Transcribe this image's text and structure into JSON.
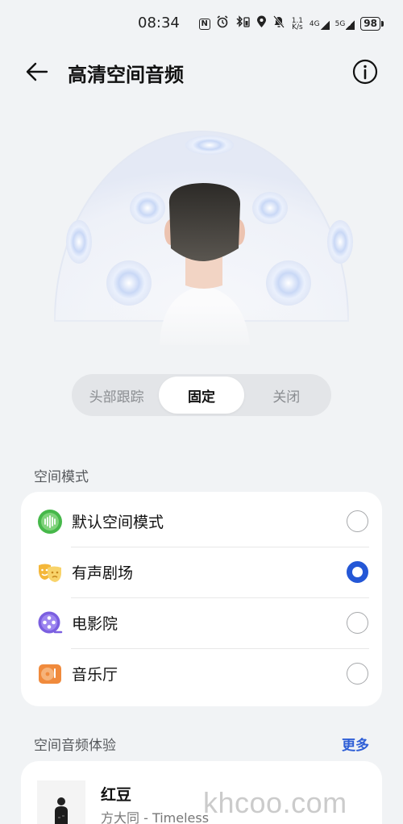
{
  "status_bar": {
    "time": "08:34",
    "nfc": "N",
    "speed_top": "1.1",
    "speed_bottom": "K/s",
    "sig1_label": "4G",
    "sig2_label": "5G",
    "battery": "98"
  },
  "header": {
    "title": "高清空间音频"
  },
  "segmented": {
    "options": [
      "头部跟踪",
      "固定",
      "关闭"
    ],
    "selected": "固定"
  },
  "spatial_mode": {
    "title": "空间模式",
    "items": [
      {
        "label": "默认空间模式",
        "icon": "waveform-icon",
        "color": "#46b84a",
        "selected": false
      },
      {
        "label": "有声剧场",
        "icon": "theater-masks-icon",
        "color": "#f4b73a",
        "selected": true
      },
      {
        "label": "电影院",
        "icon": "film-reel-icon",
        "color": "#7b5fe0",
        "selected": false
      },
      {
        "label": "音乐厅",
        "icon": "music-disc-icon",
        "color": "#f08a3c",
        "selected": false
      }
    ]
  },
  "experience": {
    "title": "空间音频体验",
    "more_label": "更多",
    "song_title": "红豆",
    "song_sub": "方大同 - Timeless"
  },
  "watermark": "khcoo.com",
  "colors": {
    "accent": "#2457d6",
    "link": "#2f5fd6",
    "background": "#f1f3f5"
  }
}
